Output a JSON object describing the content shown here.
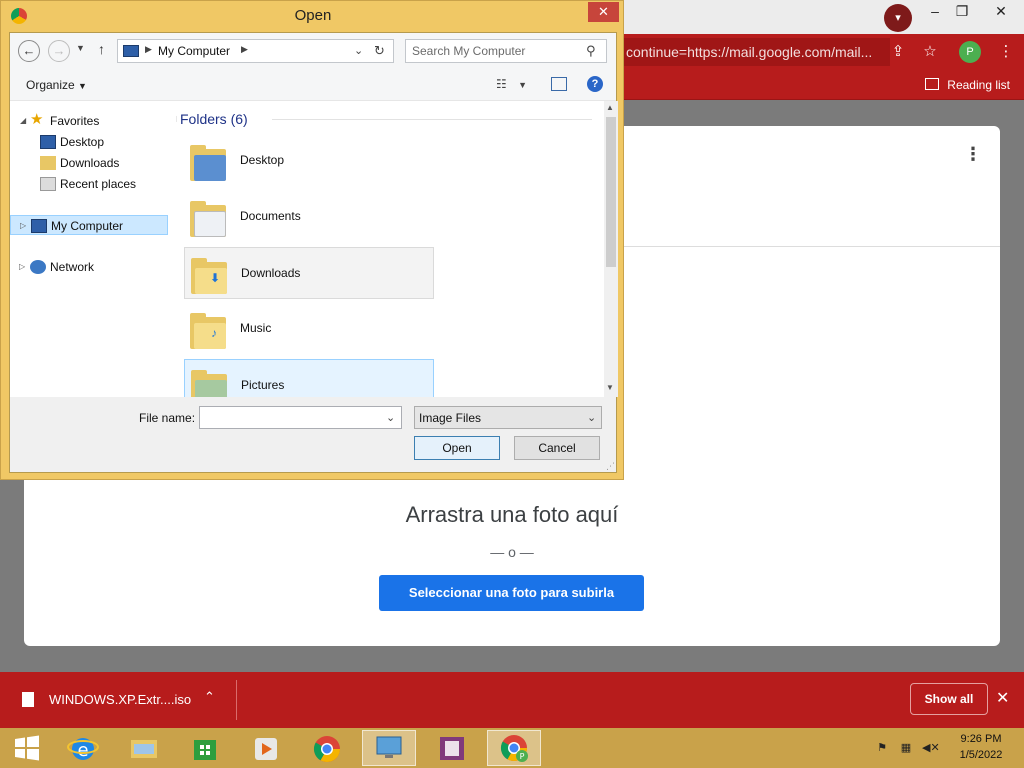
{
  "browser": {
    "omnibox_text": "continue=https://mail.google.com/mail...",
    "avatar_letter": "P",
    "reading_list": "Reading list"
  },
  "page": {
    "drop_title": "Arrastra una foto aquí",
    "or_separator": "— o —",
    "select_button": "Seleccionar una foto para subirla"
  },
  "downloads": {
    "file_name": "WINDOWS.XP.Extr....iso",
    "show_all": "Show all"
  },
  "dialog": {
    "title": "Open",
    "address": "My Computer",
    "search_placeholder": "Search My Computer",
    "organize": "Organize",
    "nav": {
      "favorites": "Favorites",
      "desktop": "Desktop",
      "downloads": "Downloads",
      "recent_places": "Recent places",
      "my_computer": "My Computer",
      "network": "Network"
    },
    "group_header": "Folders (6)",
    "folders": [
      "Desktop",
      "Documents",
      "Downloads",
      "Music",
      "Pictures"
    ],
    "file_name_label": "File name:",
    "file_name_value": "",
    "file_type": "Image Files",
    "open_button": "Open",
    "cancel_button": "Cancel"
  },
  "taskbar": {
    "time": "9:26 PM",
    "date": "1/5/2022"
  },
  "colors": {
    "chrome_red": "#b71c1c",
    "button_blue": "#1a73e8",
    "dialog_frame": "#f0c865",
    "taskbar": "#c9a24a"
  }
}
